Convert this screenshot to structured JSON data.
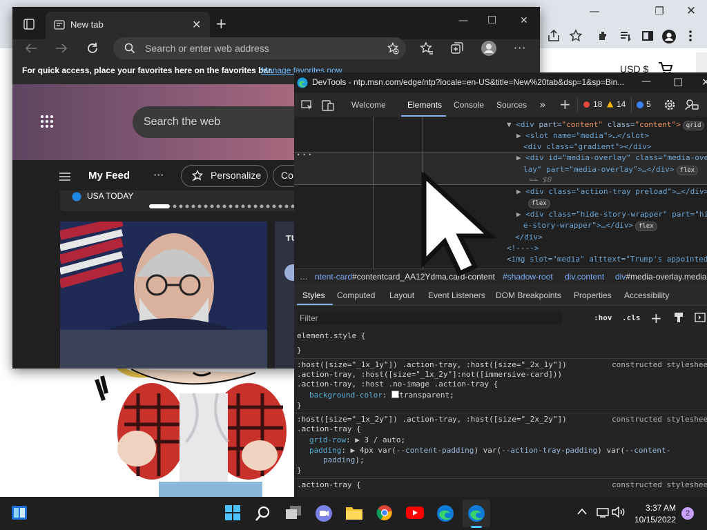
{
  "edge_window": {
    "tab_title": "New tab",
    "address_placeholder": "Search or enter web address",
    "favorites_bar_text": "For quick access, place your favorites here on the favorites bar.",
    "favorites_bar_link": "Manage favorites now"
  },
  "new_tab_page": {
    "search_placeholder": "Search the web",
    "feed_title": "My Feed",
    "feed_more": "···",
    "personalize_label": "Personalize",
    "next_pill_label": "Co",
    "carousel_source": "USA TODAY",
    "card2_label": "TU"
  },
  "background_page": {
    "price_label": "USD $"
  },
  "devtools": {
    "title": "DevTools - ntp.msn.com/edge/ntp?locale=en-US&title=New%20tab&dsp=1&sp=Bin...",
    "tabs": {
      "welcome": "Welcome",
      "elements": "Elements",
      "console": "Console",
      "sources": "Sources"
    },
    "error_count": "18",
    "warning_count": "14",
    "info_count": "5",
    "dom": {
      "line1_a": "<div ",
      "line1_b": "part=",
      "line1_c": "\"content\"",
      "line1_d": " class=",
      "line1_e": "\"content\">",
      "line1_badge": "grid",
      "line2": "<slot name=\"media\">…</slot>",
      "line3": "<div class=\"gradient\"></div>",
      "line4": "<div id=\"media-overlay\" class=\"media-over",
      "line5": "lay\" part=\"media-overlay\">…</div>",
      "line5_badge": "flex",
      "line6": "== $0",
      "line7": "<div class=\"action-tray preload\">…</div>",
      "line8_badge": "flex",
      "line9": "<div class=\"hide-story-wrapper\" part=\"hid",
      "line10": "e-story-wrapper\">…</div>",
      "line10_badge": "flex",
      "line11": "</div>",
      "line12": "<!---->",
      "line13": "<img slot=\"media\" alttext=\"Trump's appointed",
      "gutter_ellipsis": "···"
    },
    "breadcrumbs": {
      "ellipsis": "…",
      "crumb1_a": "ntent-card",
      "crumb1_b": "#contentcard_AA12Ydma.card-content",
      "crumb2": "#shadow-root",
      "crumb3": "div.content",
      "crumb4_a": "div",
      "crumb4_b": "#media-overlay.media"
    },
    "styles_tabs": {
      "styles": "Styles",
      "computed": "Computed",
      "layout": "Layout",
      "event_listeners": "Event Listeners",
      "dom_breakpoints": "DOM Breakpoints",
      "properties": "Properties",
      "accessibility": "Accessibility"
    },
    "filter_placeholder": "Filter",
    "hov_label": ":hov",
    "cls_label": ".cls",
    "rules": {
      "r0_selector": "element.style {",
      "r0_close": "}",
      "r1_sel1": ":host([size=\"_1x_1y\"]) .action-tray, :host([size=\"_2x_1y\"])",
      "r1_sel2": ".action-tray, :host([size=\"_1x_2y\"]:not([immersive-card]))",
      "r1_sel3": ".action-tray, :host .no-image .action-tray {",
      "r1_prop": "background-color",
      "r1_val": "transparent;",
      "r1_close": "}",
      "r1_src": "constructed styleshee",
      "r2_sel1": ":host([size=\"_1x_2y\"]) .action-tray, :host([size=\"_2x_2y\"])",
      "r2_sel2": ".action-tray {",
      "r2_prop1": "grid-row",
      "r2_val1": "3 / auto;",
      "r2_prop2": "padding",
      "r2_val2_a": "4px var(",
      "r2_val2_b": "--content-padding",
      "r2_val2_c": ") var(",
      "r2_val2_d": "--action-tray-padding",
      "r2_val2_e": ") var(",
      "r2_val2_f": "--content-",
      "r2_val2_g": "padding",
      "r2_val2_h": ");",
      "r2_close": "}",
      "r2_src": "constructed styleshee",
      "r3_sel": ".action-tray {",
      "r3_src": "constructed styleshee"
    }
  },
  "taskbar": {
    "time": "3:37 AM",
    "date": "10/15/2022",
    "notification_count": "2"
  },
  "colors": {
    "accent_link": "#6cb8ff",
    "devtools_tab_underline": "#8ab4f8",
    "error": "#e8473e",
    "warning": "#f5b400",
    "info": "#3b82f6"
  }
}
